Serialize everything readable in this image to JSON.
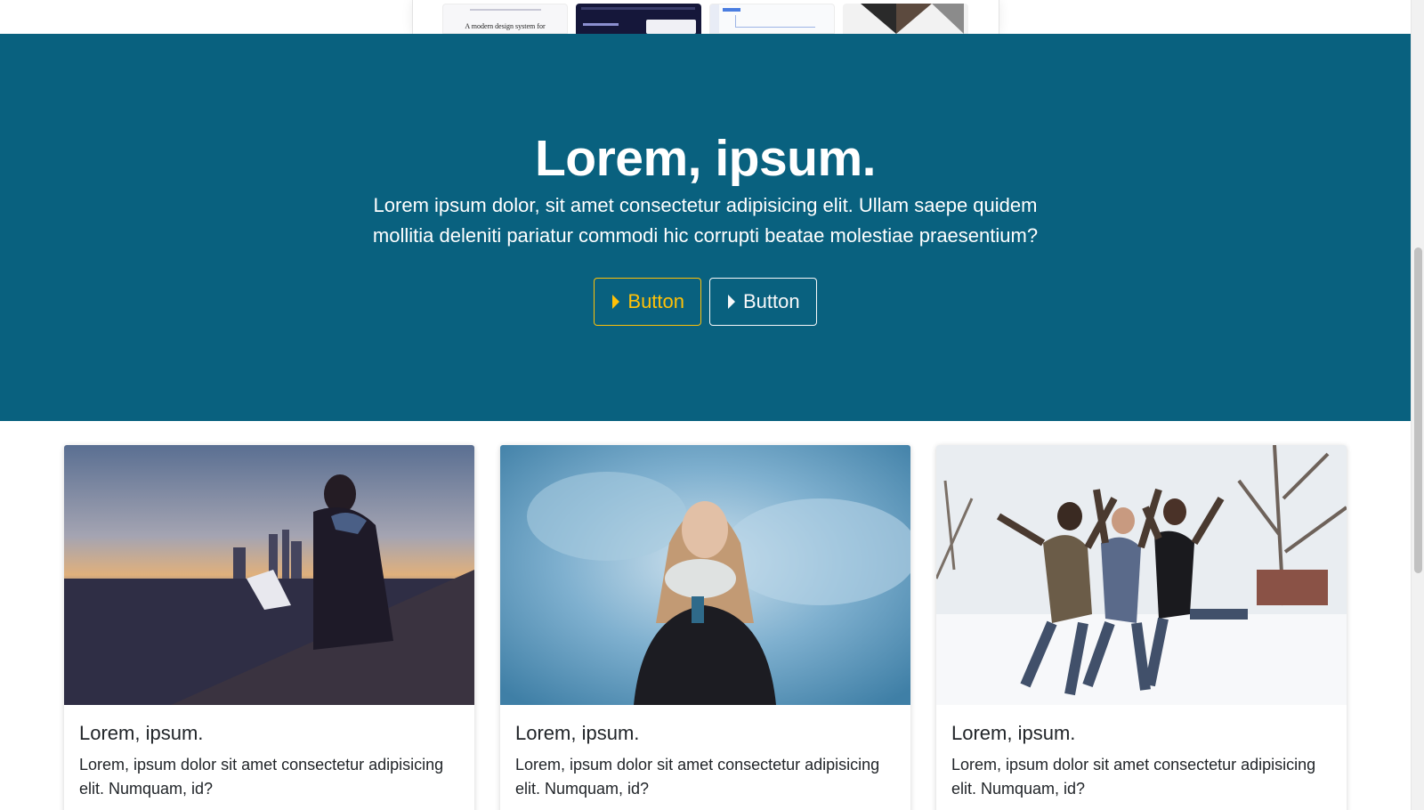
{
  "showcase": {
    "thumb_1_text": "A modern design system for"
  },
  "hero": {
    "title": "Lorem, ipsum.",
    "lead": "Lorem ipsum dolor, sit amet consectetur adipisicing elit. Ullam saepe quidem mollitia deleniti pariatur commodi hic corrupti beatae molestiae praesentium?",
    "buttons": [
      {
        "label": "Button",
        "icon": "caret-right-icon",
        "color": "#ffc107"
      },
      {
        "label": "Button",
        "icon": "caret-right-icon",
        "color": "#f8f9fa"
      }
    ],
    "background": "#09617f"
  },
  "cards": [
    {
      "image": "man-with-laptop-at-sunset",
      "title": "Lorem, ipsum.",
      "text": "Lorem, ipsum dolor sit amet consectetur adipisicing elit. Numquam, id?"
    },
    {
      "image": "woman-with-smoke",
      "title": "Lorem, ipsum.",
      "text": "Lorem, ipsum dolor sit amet consectetur adipisicing elit. Numquam, id?"
    },
    {
      "image": "friends-jumping-in-snow",
      "title": "Lorem, ipsum.",
      "text": "Lorem, ipsum dolor sit amet consectetur adipisicing elit. Numquam, id?"
    }
  ]
}
